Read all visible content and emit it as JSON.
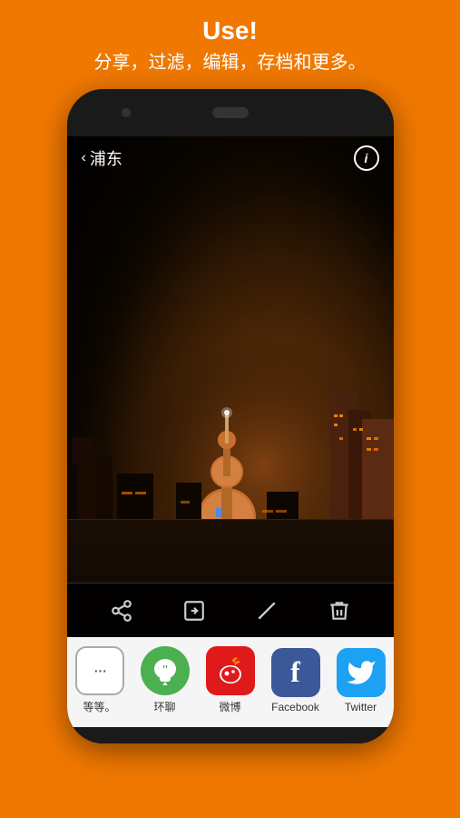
{
  "header": {
    "title": "Use!",
    "subtitle": "分享，过滤，编辑，存档和更多。"
  },
  "nav": {
    "back_label": "浦东",
    "info_label": "i"
  },
  "toolbar": {
    "share_icon": "share",
    "import_icon": "import",
    "edit_icon": "edit",
    "delete_icon": "delete"
  },
  "share_apps": [
    {
      "id": "more",
      "label": "等等。",
      "icon": "···"
    },
    {
      "id": "huanping",
      "label": "环聊",
      "icon": "❞"
    },
    {
      "id": "weibo",
      "label": "微博",
      "icon": "W"
    },
    {
      "id": "facebook",
      "label": "Facebook",
      "icon": "f"
    },
    {
      "id": "twitter",
      "label": "Twitter",
      "icon": "🐦"
    }
  ],
  "colors": {
    "brand_orange": "#F07800",
    "phone_bg": "#1a1a1a",
    "twitter_blue": "#1da1f2",
    "facebook_blue": "#3b5998",
    "weibo_red": "#e0191b",
    "hangouts_green": "#4CAF50"
  }
}
